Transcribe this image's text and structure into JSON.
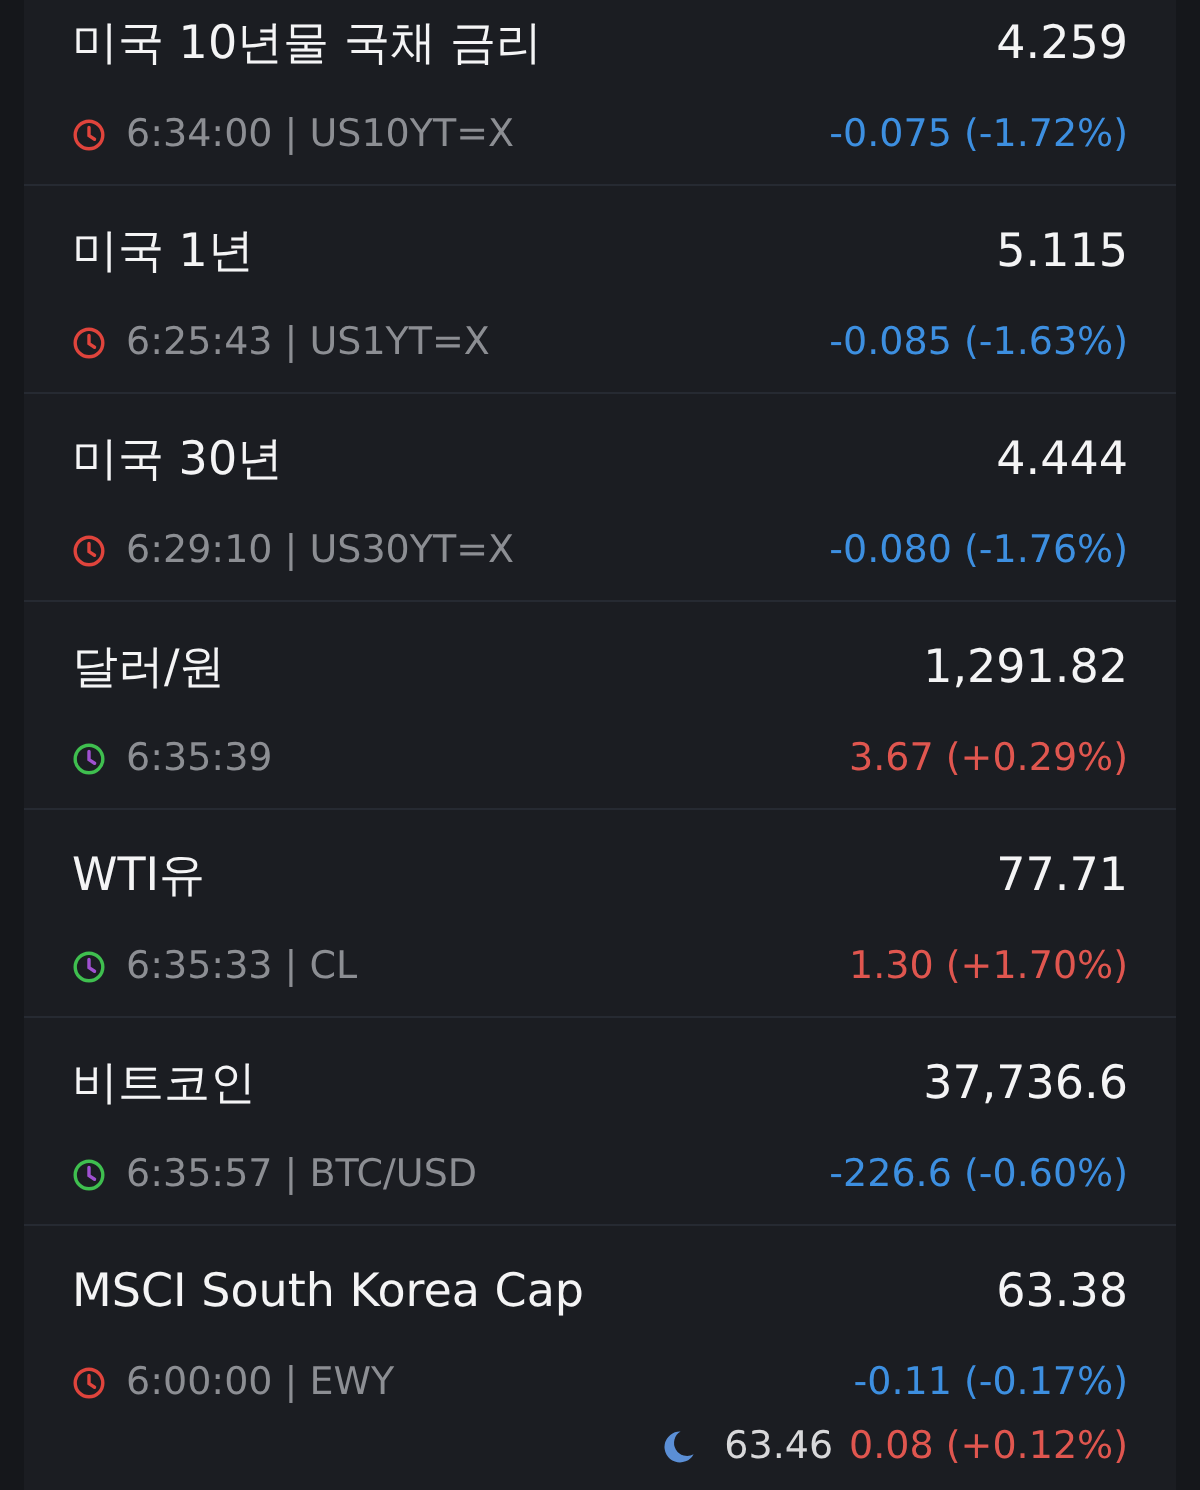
{
  "quotes": [
    {
      "name": "미국 10년물 국채 금리",
      "price": "4.259",
      "market_open": false,
      "time": "6:34:00 | US10YT=X",
      "change": "-0.075 (-1.72%)",
      "color": "#3d8fe0"
    },
    {
      "name": "미국 1년",
      "price": "5.115",
      "market_open": false,
      "time": "6:25:43 | US1YT=X",
      "change": "-0.085 (-1.63%)",
      "color": "#3d8fe0"
    },
    {
      "name": "미국 30년",
      "price": "4.444",
      "market_open": false,
      "time": "6:29:10 | US30YT=X",
      "change": "-0.080 (-1.76%)",
      "color": "#3d8fe0"
    },
    {
      "name": "달러/원",
      "price": "1,291.82",
      "market_open": true,
      "time": "6:35:39",
      "change": "3.67 (+0.29%)",
      "color": "#e0564f"
    },
    {
      "name": "WTI유",
      "price": "77.71",
      "market_open": true,
      "time": "6:35:33 | CL",
      "change": "1.30 (+1.70%)",
      "color": "#e0564f"
    },
    {
      "name": "비트코인",
      "price": "37,736.6",
      "market_open": true,
      "time": "6:35:57 | BTC/USD",
      "change": "-226.6 (-0.60%)",
      "color": "#3d8fe0"
    },
    {
      "name": "MSCI South Korea Cap",
      "price": "63.38",
      "market_open": false,
      "time": "6:00:00 | EWY",
      "change": "-0.11 (-0.17%)",
      "color": "#3d8fe0",
      "after_hours": {
        "price": "63.46",
        "change": "0.08 (+0.12%)",
        "color": "#e0564f"
      }
    }
  ]
}
